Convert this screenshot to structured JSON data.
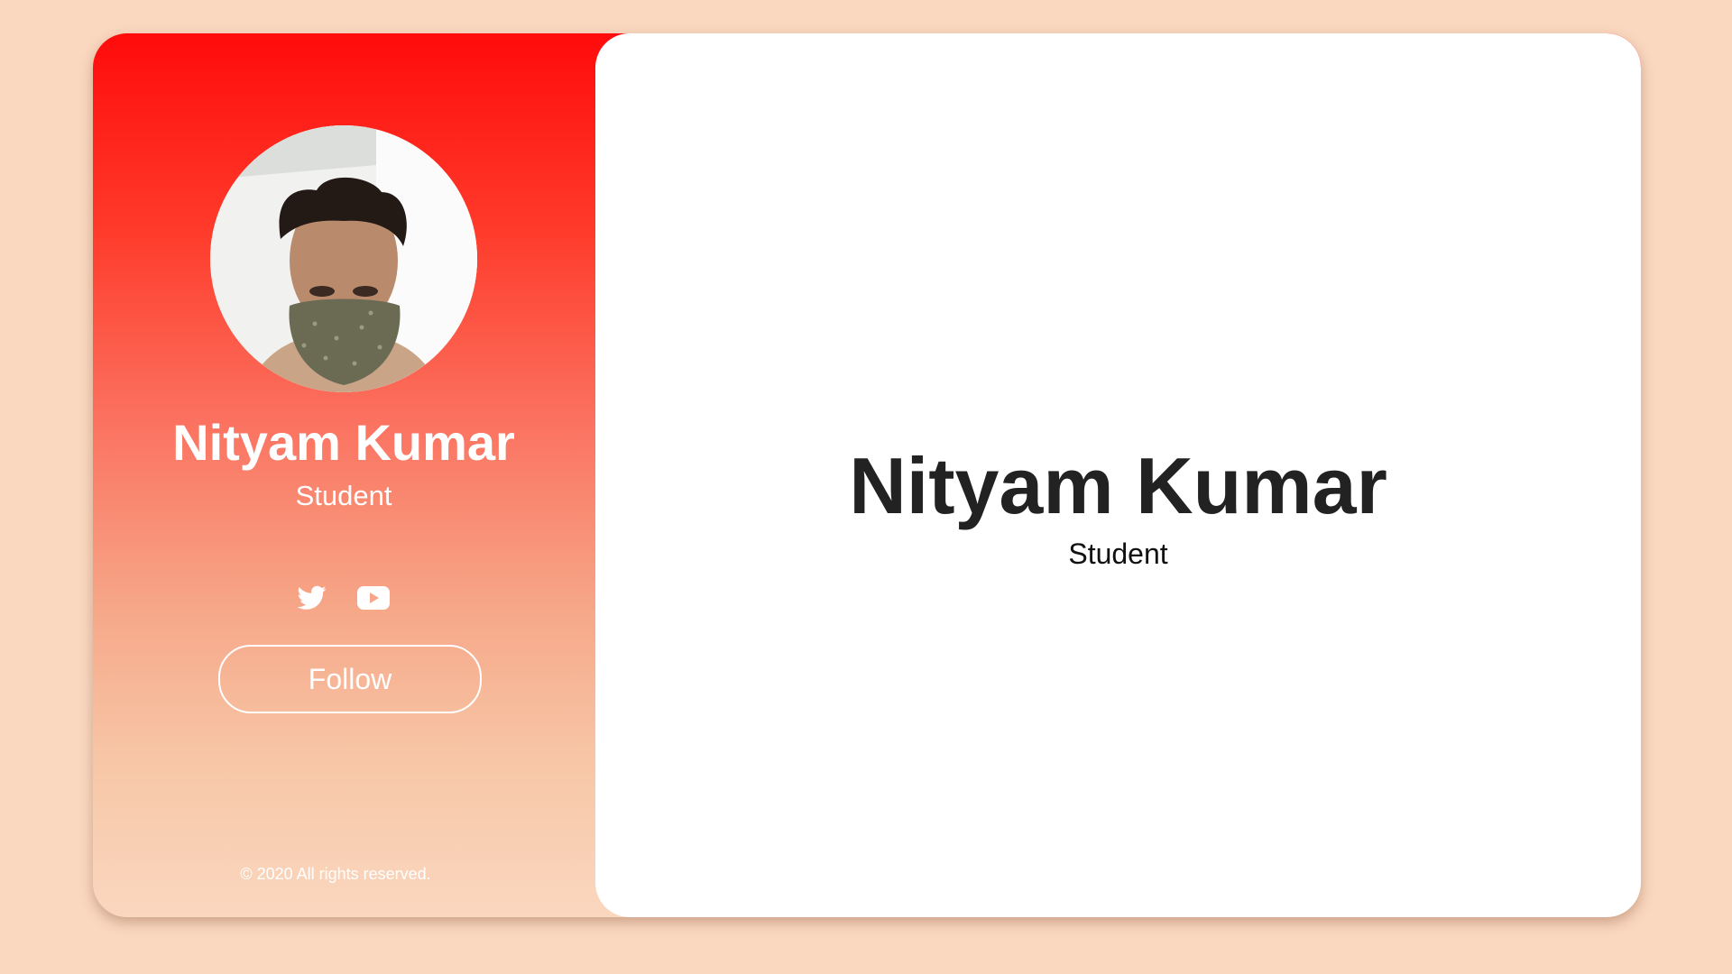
{
  "profile": {
    "name": "Nityam Kumar",
    "role": "Student",
    "avatar_alt": "profile-photo"
  },
  "social": {
    "items": [
      {
        "name": "twitter-icon"
      },
      {
        "name": "youtube-icon"
      }
    ]
  },
  "actions": {
    "follow_label": "Follow"
  },
  "footer": {
    "copyright": "© 2020 All rights reserved."
  },
  "main": {
    "name": "Nityam Kumar",
    "role": "Student"
  },
  "colors": {
    "page_background": "#fad7bf",
    "gradient_top": "#ff0b0b",
    "gradient_bottom": "#fad7bf",
    "panel": "#ffffff",
    "heading": "#222222"
  }
}
